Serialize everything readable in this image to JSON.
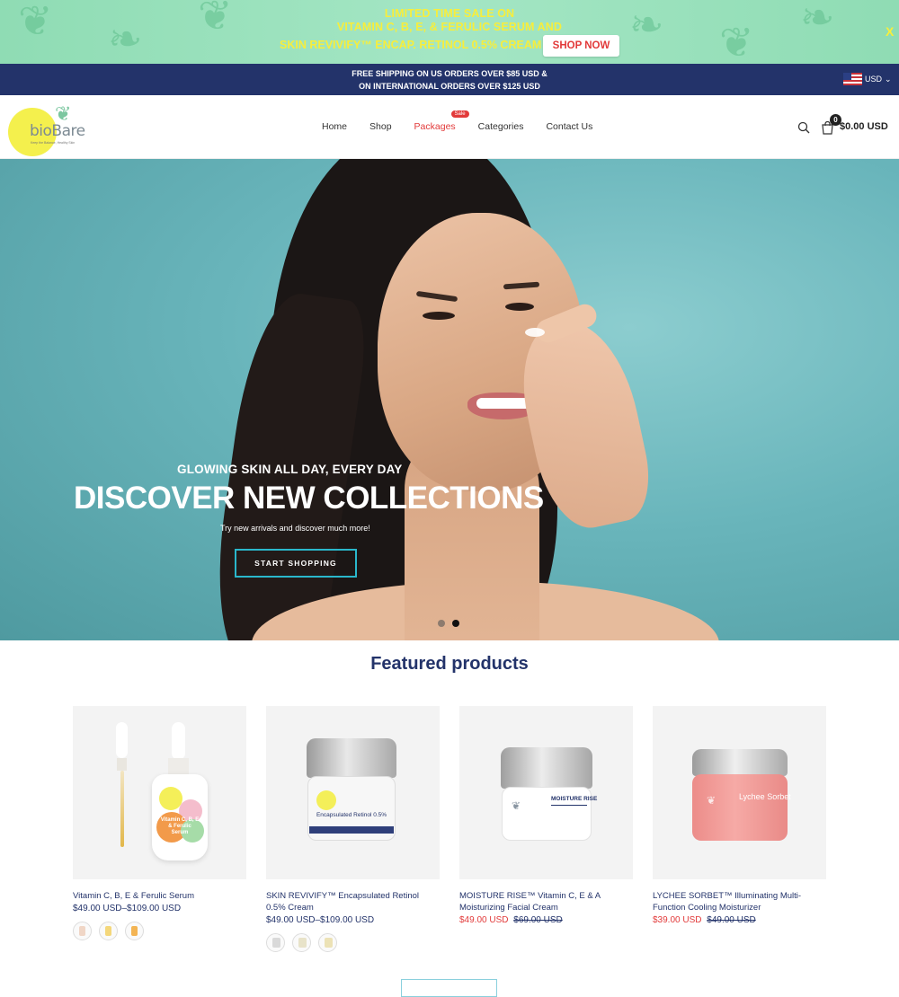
{
  "promo": {
    "line1": "LIMITED TIME SALE ON",
    "line2": "VITAMIN C, B, E, & FERULIC SERUM AND",
    "line3": "SKIN REVIVIFY™ ENCAP. RETINOL 0.5% CREAM",
    "cta": "SHOP NOW",
    "close": "X",
    "bg_color": "#9ee2c0",
    "text_color": "#f7ee3c"
  },
  "shipping": {
    "line1": "FREE SHIPPING ON US ORDERS OVER $85 USD &",
    "line2": "ON INTERNATIONAL ORDERS OVER $125 USD",
    "currency": "USD",
    "bg_color": "#23336a"
  },
  "header": {
    "logo_text": "bioBare",
    "logo_tagline": "Keep the Balance, Healthy Skin",
    "nav": [
      {
        "label": "Home"
      },
      {
        "label": "Shop"
      },
      {
        "label": "Packages",
        "badge": "Sale"
      },
      {
        "label": "Categories"
      },
      {
        "label": "Contact Us"
      }
    ],
    "cart_count": "0",
    "cart_total": "$0.00 USD"
  },
  "hero": {
    "subtitle": "GLOWING SKIN ALL DAY, EVERY DAY",
    "title": "DISCOVER NEW COLLECTIONS",
    "description": "Try new arrivals and discover much more!",
    "button": "START SHOPPING",
    "slides": 2,
    "active_slide": 2
  },
  "featured": {
    "title": "Featured products",
    "products": [
      {
        "name": "Vitamin C, B, E & Ferulic Serum",
        "price": "$49.00 USD–$109.00 USD",
        "label_text": "Vitamin C, B, E & Ferulic Serum"
      },
      {
        "name": "SKIN REVIVIFY™ Encapsulated Retinol 0.5% Cream",
        "price": "$49.00 USD–$109.00 USD",
        "label_text": "Encapsulated Retinol 0.5%"
      },
      {
        "name": "MOISTURE RISE™ Vitamin C, E & A Moisturizing Facial Cream",
        "sale_price": "$49.00 USD",
        "old_price": "$69.00 USD",
        "label_text": "MOISTURE RISE"
      },
      {
        "name": "LYCHEE SORBET™ Illuminating Multi-Function Cooling Moisturizer",
        "sale_price": "$39.00 USD",
        "old_price": "$49.00 USD",
        "label_text": "Lychee Sorbet"
      }
    ]
  },
  "colors": {
    "brand_navy": "#23336a",
    "sale_red": "#e23a3a",
    "accent_teal": "#2ab7cb"
  }
}
